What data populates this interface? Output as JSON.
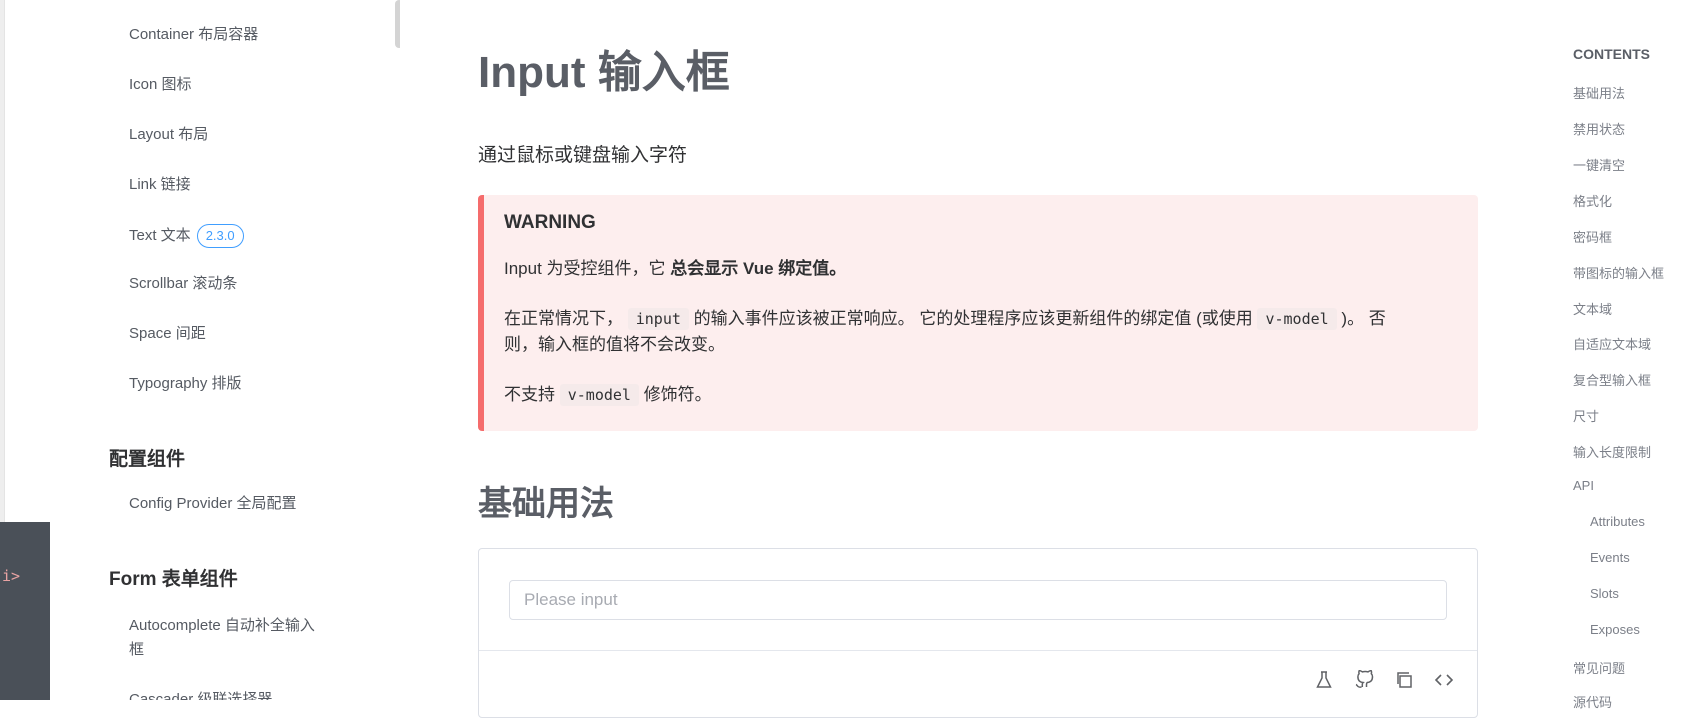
{
  "sidebar": {
    "items": [
      {
        "label": "Container 布局容器"
      },
      {
        "label": "Icon 图标"
      },
      {
        "label": "Layout 布局"
      },
      {
        "label": "Link 链接"
      },
      {
        "label": "Text 文本",
        "badge": "2.3.0"
      },
      {
        "label": "Scrollbar 滚动条"
      },
      {
        "label": "Space 间距"
      },
      {
        "label": "Typography 排版"
      }
    ],
    "config_heading": "配置组件",
    "config_items": [
      {
        "label": "Config Provider 全局配置"
      }
    ],
    "form_heading": "Form 表单组件",
    "form_items": [
      {
        "label_line1": "Autocomplete 自动补全输入",
        "label_line2": "框"
      },
      {
        "label": "Cascader 级联选择器"
      }
    ]
  },
  "dark_panel": {
    "text": "i>"
  },
  "main": {
    "title": "Input 输入框",
    "description": "通过鼠标或键盘输入字符",
    "warning": {
      "title": "WARNING",
      "p1_text": "Input 为受控组件，它 ",
      "p1_bold": "总会显示 Vue 绑定值。",
      "p2_a": "在正常情况下，",
      "p2_code1": "input",
      "p2_b": "的输入事件应该被正常响应。 它的处理程序应该更新组件的绑定值 (或使用",
      "p2_code2": "v-model",
      "p2_c": ")。 否",
      "p2_d": "则，输入框的值将不会改变。",
      "p3_a": "不支持",
      "p3_code": "v-model",
      "p3_b": "修饰符。"
    },
    "section_title": "基础用法",
    "demo": {
      "input_placeholder": "Please input",
      "input_value": "",
      "tools": [
        "playground-flask-icon",
        "github-icon",
        "copy-icon",
        "code-icon"
      ]
    }
  },
  "toc": {
    "title": "CONTENTS",
    "items": [
      {
        "label": "基础用法",
        "level": 1
      },
      {
        "label": "禁用状态",
        "level": 1
      },
      {
        "label": "一键清空",
        "level": 1
      },
      {
        "label": "格式化",
        "level": 1
      },
      {
        "label": "密码框",
        "level": 1
      },
      {
        "label": "带图标的输入框",
        "level": 1
      },
      {
        "label": "文本域",
        "level": 1
      },
      {
        "label": "自适应文本域",
        "level": 1
      },
      {
        "label": "复合型输入框",
        "level": 1
      },
      {
        "label": "尺寸",
        "level": 1
      },
      {
        "label": "输入长度限制",
        "level": 1
      },
      {
        "label": "API",
        "level": 1
      },
      {
        "label": "Attributes",
        "level": 2
      },
      {
        "label": "Events",
        "level": 2
      },
      {
        "label": "Slots",
        "level": 2
      },
      {
        "label": "Exposes",
        "level": 2
      },
      {
        "label": "常见问题",
        "level": 1
      },
      {
        "label": "源代码",
        "level": 1
      }
    ]
  },
  "colors": {
    "accent": "#409eff",
    "warning_border": "#f56c6c",
    "warning_bg": "#fdeeee"
  }
}
